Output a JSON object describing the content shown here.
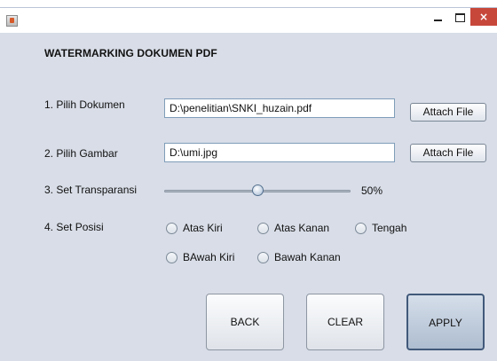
{
  "titlebar": {
    "app_icon": "java-cup-icon",
    "minimize_glyph": "",
    "maximize_glyph": "",
    "close_glyph": "×"
  },
  "form": {
    "title": "WATERMARKING DOKUMEN PDF",
    "document": {
      "label": "1. Pilih Dokumen",
      "value": "D:\\penelitian\\SNKI_huzain.pdf",
      "button": "Attach File"
    },
    "image": {
      "label": "2. Pilih Gambar",
      "value": "D:\\umi.jpg",
      "button": "Attach File"
    },
    "transparency": {
      "label": "3. Set Transparansi",
      "value_percent": 50,
      "value_text": "50%"
    },
    "position": {
      "label": "4. Set Posisi",
      "options": [
        "Atas Kiri",
        "Atas Kanan",
        "Tengah",
        "BAwah Kiri",
        "Bawah Kanan"
      ]
    }
  },
  "actions": {
    "back": "BACK",
    "clear": "CLEAR",
    "apply": "APPLY"
  },
  "colors": {
    "window_bg": "#d8dde7",
    "close_button": "#c7483b",
    "field_border": "#7f9db9",
    "apply_border": "#41597a"
  }
}
